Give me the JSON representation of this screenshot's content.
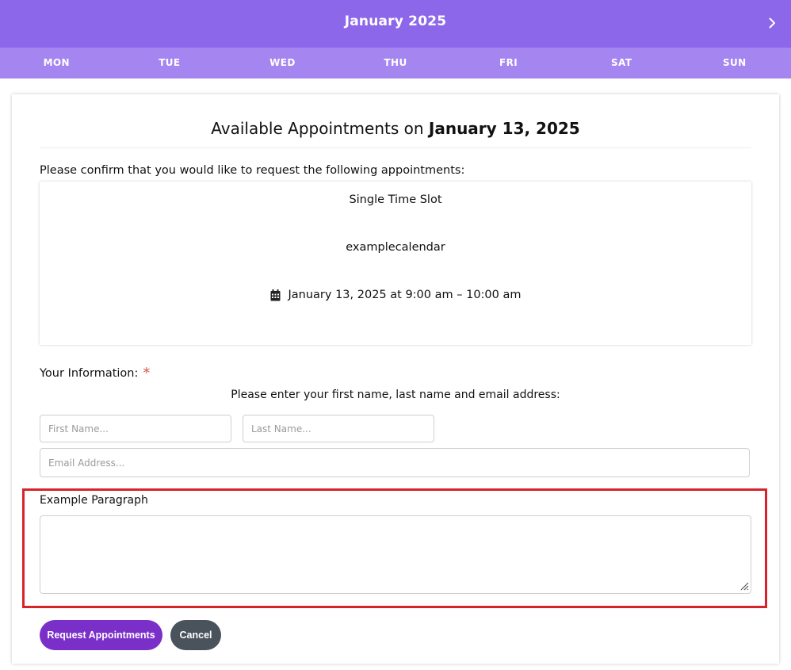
{
  "calendar": {
    "month_title": "January 2025",
    "next_icon": "chevron-right-icon",
    "weekdays": [
      "MON",
      "TUE",
      "WED",
      "THU",
      "FRI",
      "SAT",
      "SUN"
    ],
    "colors": {
      "header": "#8c67ea",
      "weekday_bar": "#a585f0"
    }
  },
  "card": {
    "title_prefix": "Available Appointments on",
    "title_date": "January 13, 2025",
    "confirm_text": "Please confirm that you would like to request the following appointments:",
    "appointment": {
      "slot_type": "Single Time Slot",
      "calendar_name": "examplecalendar",
      "datetime_icon": "calendar-icon",
      "datetime": "January 13, 2025 at 9:00 am – 10:00 am"
    },
    "your_information_label": "Your Information:",
    "required_marker": "*",
    "info_help": "Please enter your first name, last name and email address:",
    "fields": {
      "first_name_placeholder": "First Name...",
      "last_name_placeholder": "Last Name...",
      "email_placeholder": "Email Address...",
      "paragraph_label": "Example Paragraph",
      "paragraph_value": ""
    },
    "buttons": {
      "request": "Request Appointments",
      "cancel": "Cancel"
    },
    "colors": {
      "request_button": "#7b2fc9",
      "cancel_button": "#4a525c",
      "highlight": "#d8232a",
      "required": "#d9534f"
    }
  }
}
